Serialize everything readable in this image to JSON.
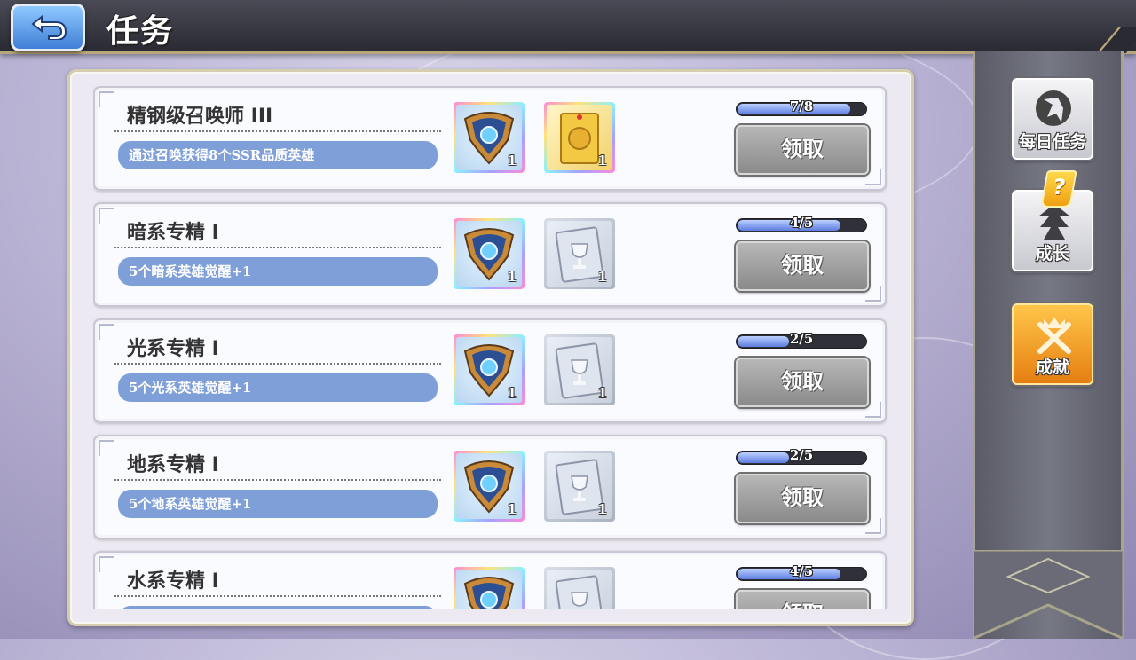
{
  "header": {
    "title": "任务"
  },
  "tasks": [
    {
      "title": "精钢级召唤师 III",
      "desc": "通过召唤获得8个SSR品质英雄",
      "progress": "7/8",
      "progress_value": 0.875,
      "rewards": [
        {
          "type": "emblem",
          "qty": "1"
        },
        {
          "type": "gold-card",
          "qty": "1"
        }
      ],
      "claim": "领取"
    },
    {
      "title": "暗系专精 I",
      "desc": "5个暗系英雄觉醒+1",
      "progress": "4/5",
      "progress_value": 0.8,
      "rewards": [
        {
          "type": "emblem",
          "qty": "1"
        },
        {
          "type": "silver-card",
          "qty": "1"
        }
      ],
      "claim": "领取"
    },
    {
      "title": "光系专精 I",
      "desc": "5个光系英雄觉醒+1",
      "progress": "2/5",
      "progress_value": 0.4,
      "rewards": [
        {
          "type": "emblem",
          "qty": "1"
        },
        {
          "type": "silver-card",
          "qty": "1"
        }
      ],
      "claim": "领取"
    },
    {
      "title": "地系专精 I",
      "desc": "5个地系英雄觉醒+1",
      "progress": "2/5",
      "progress_value": 0.4,
      "rewards": [
        {
          "type": "emblem",
          "qty": "1"
        },
        {
          "type": "silver-card",
          "qty": "1"
        }
      ],
      "claim": "领取"
    },
    {
      "title": "水系专精 I",
      "desc": "",
      "progress": "4/5",
      "progress_value": 0.8,
      "rewards": [
        {
          "type": "emblem",
          "qty": ""
        },
        {
          "type": "silver-card",
          "qty": ""
        }
      ],
      "claim": "领取"
    }
  ],
  "sidebar": {
    "tabs": [
      {
        "label": "每日任务",
        "icon": "daily-task-icon",
        "active": false
      },
      {
        "label": "成长",
        "icon": "growth-icon",
        "active": false,
        "badge": "?"
      },
      {
        "label": "成就",
        "icon": "achievement-icon",
        "active": true
      }
    ]
  },
  "colors": {
    "accent": "#7f9fd8",
    "active_tab": "#f0a020",
    "frame": "#d6cdb0"
  }
}
